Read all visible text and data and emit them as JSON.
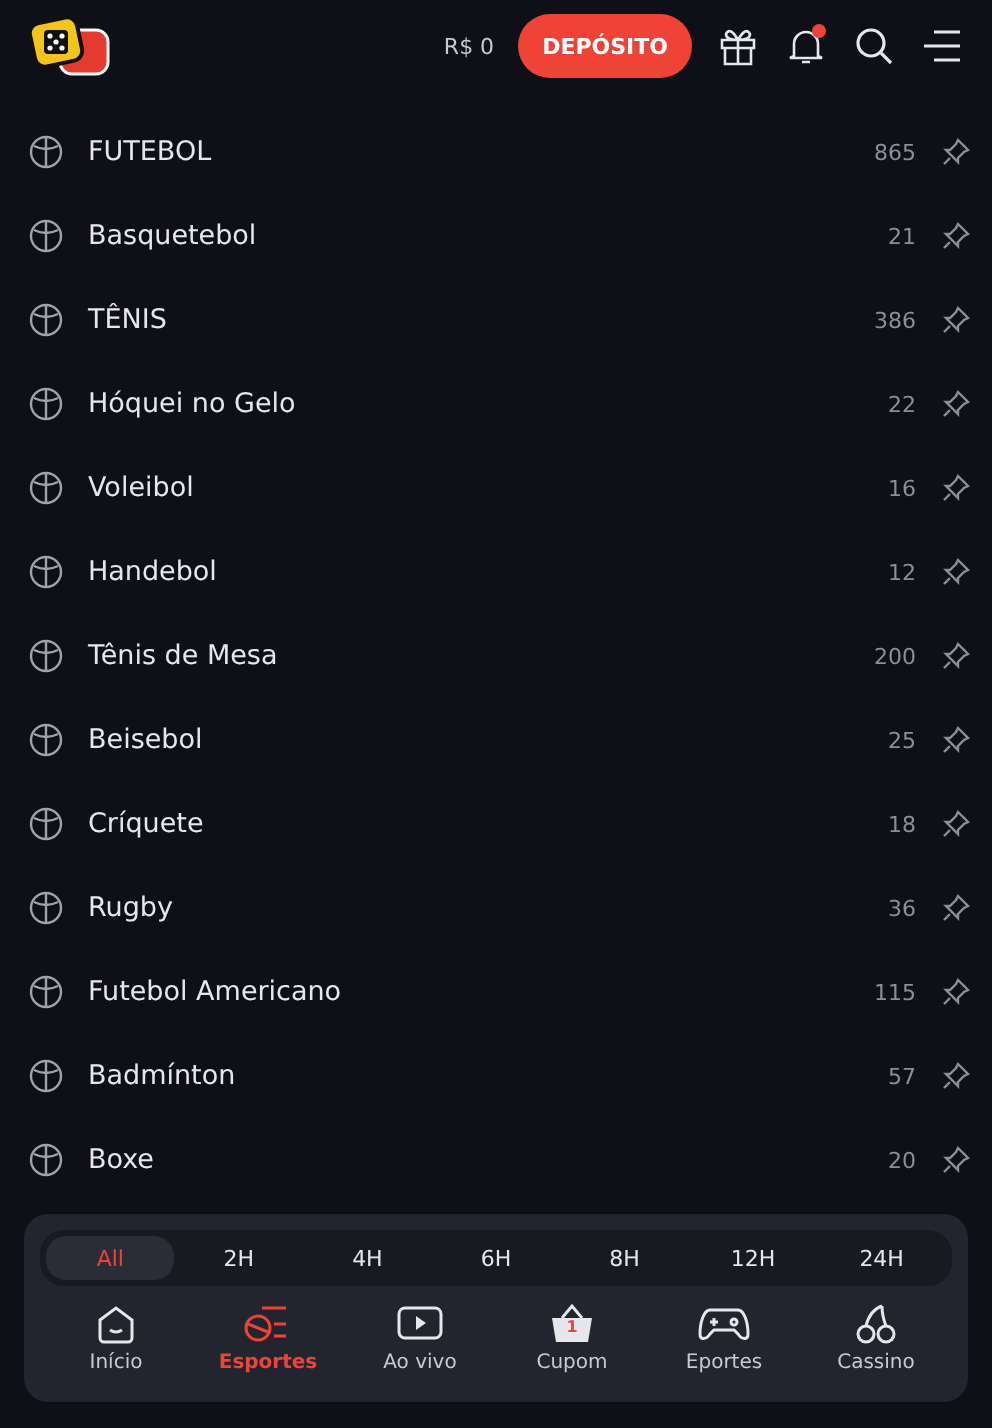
{
  "header": {
    "balance": "R$ 0",
    "deposit_button": "DEPÓSITO",
    "notification_dot": true
  },
  "sports": [
    {
      "name": "FUTEBOL",
      "count": "865"
    },
    {
      "name": "Basquetebol",
      "count": "21"
    },
    {
      "name": "TÊNIS",
      "count": "386"
    },
    {
      "name": "Hóquei no Gelo",
      "count": "22"
    },
    {
      "name": "Voleibol",
      "count": "16"
    },
    {
      "name": "Handebol",
      "count": "12"
    },
    {
      "name": "Tênis de Mesa",
      "count": "200"
    },
    {
      "name": "Beisebol",
      "count": "25"
    },
    {
      "name": "Críquete",
      "count": "18"
    },
    {
      "name": "Rugby",
      "count": "36"
    },
    {
      "name": "Futebol Americano",
      "count": "115"
    },
    {
      "name": "Badmínton",
      "count": "57"
    },
    {
      "name": "Boxe",
      "count": "20"
    }
  ],
  "time_filters": [
    {
      "label": "All",
      "selected": true
    },
    {
      "label": "2H",
      "selected": false
    },
    {
      "label": "4H",
      "selected": false
    },
    {
      "label": "6H",
      "selected": false
    },
    {
      "label": "8H",
      "selected": false
    },
    {
      "label": "12H",
      "selected": false
    },
    {
      "label": "24H",
      "selected": false
    }
  ],
  "bottom_nav": [
    {
      "label": "Início",
      "kind": "home",
      "selected": false
    },
    {
      "label": "Esportes",
      "kind": "sports",
      "selected": true
    },
    {
      "label": "Ao vivo",
      "kind": "live",
      "selected": false
    },
    {
      "label": "Cupom",
      "kind": "coupon",
      "selected": false,
      "badge": "1"
    },
    {
      "label": "Eportes",
      "kind": "esports",
      "selected": false
    },
    {
      "label": "Cassino",
      "kind": "casino",
      "selected": false
    }
  ]
}
